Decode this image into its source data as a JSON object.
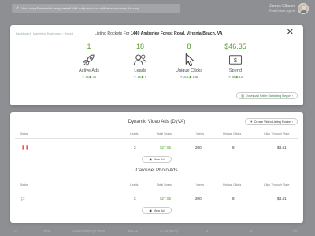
{
  "topbar": {
    "notice": "Your Listing Rocket ad is being created! We'll notify you in the notification area when it's ready!",
    "user_name": "James Gibson",
    "user_role": "Real Estate Agent"
  },
  "modal": {
    "breadcrumb": "Dashboard › Marketing Dashboard › Report",
    "listing_prefix": "Listing Rockets For",
    "listing_address": "1449 Amberley Forest Road, Virginia Beach, VA",
    "stats": [
      {
        "value": "1",
        "label": "Active Ads",
        "icon": "rocket-icon",
        "sub_a": "38",
        "sub_b": "38"
      },
      {
        "value": "18",
        "label": "Leads",
        "icon": "users-icon",
        "sub_a": "18",
        "sub_b": "9"
      },
      {
        "value": "8",
        "label": "Unique Clicks",
        "icon": "cursor-icon",
        "sub_a": "201",
        "sub_b": "108"
      },
      {
        "value": "$46.35",
        "label": "Spend",
        "icon": "dollar-bill-icon",
        "sub_a": "38",
        "sub_b": "14"
      }
    ],
    "download_label": "Download Seller Marketing Report ›"
  },
  "video_section": {
    "title": "Dynamic Video Ads (DyVA)",
    "create_label": "Create Video Listing Rocket ›",
    "columns": [
      "Status",
      "Leads",
      "Total Spend",
      "Views",
      "Unique Clicks",
      "Click Through Rate"
    ],
    "row": {
      "leads": "3",
      "spend": "$27.55",
      "views": "200",
      "clicks": "8",
      "ctr": "$3.41"
    },
    "view_label": "View Ad"
  },
  "carousel_section": {
    "title": "Carousel Photo Ads",
    "columns": [
      "Status",
      "Leads",
      "Total Spend",
      "Views",
      "Unique Clicks",
      "Click Through Rate"
    ],
    "row": {
      "leads": "3",
      "spend": "$27.55",
      "views": "200",
      "clicks": "8",
      "ctr": "$3.41"
    },
    "view_label": "View Ad"
  },
  "bottom_row": {
    "status": "New",
    "address": "1449 Amberley Forest",
    "spend": "$46.22",
    "ctr": "$7.64 (64%)",
    "views": "2",
    "clicks": "0",
    "rate": "N/A"
  },
  "colors": {
    "accent_green": "#5aa02c",
    "overlay": "#8e8f93",
    "paused_red": "#e05a5a"
  }
}
